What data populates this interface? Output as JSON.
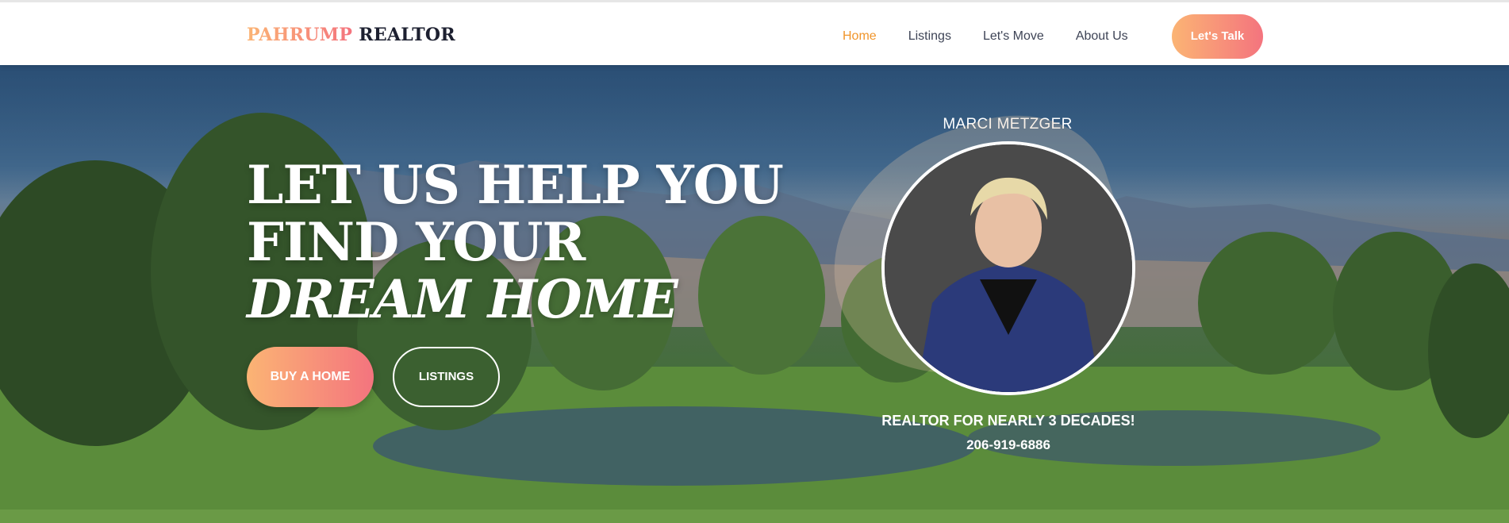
{
  "header": {
    "logo_accent": "PAHRUMP",
    "logo_rest": "REALTOR",
    "nav": [
      {
        "label": "Home",
        "active": true
      },
      {
        "label": "Listings",
        "active": false
      },
      {
        "label": "Let's Move",
        "active": false
      },
      {
        "label": "About Us",
        "active": false
      }
    ],
    "cta_label": "Let's Talk"
  },
  "hero": {
    "headline_line1": "LET US HELP YOU",
    "headline_line2": "FIND YOUR",
    "headline_line3": "DREAM HOME",
    "buy_button": "BUY A HOME",
    "listings_button": "LISTINGS",
    "agent_name": "MARCI METZGER",
    "tagline": "REALTOR FOR NEARLY 3 DECADES!",
    "phone": "206-919-6886"
  },
  "colors": {
    "accent_start": "#fbb474",
    "accent_end": "#f4747e",
    "nav_active": "#f0952b",
    "nav_text": "#3e4456",
    "logo_dark": "#1d2030"
  }
}
